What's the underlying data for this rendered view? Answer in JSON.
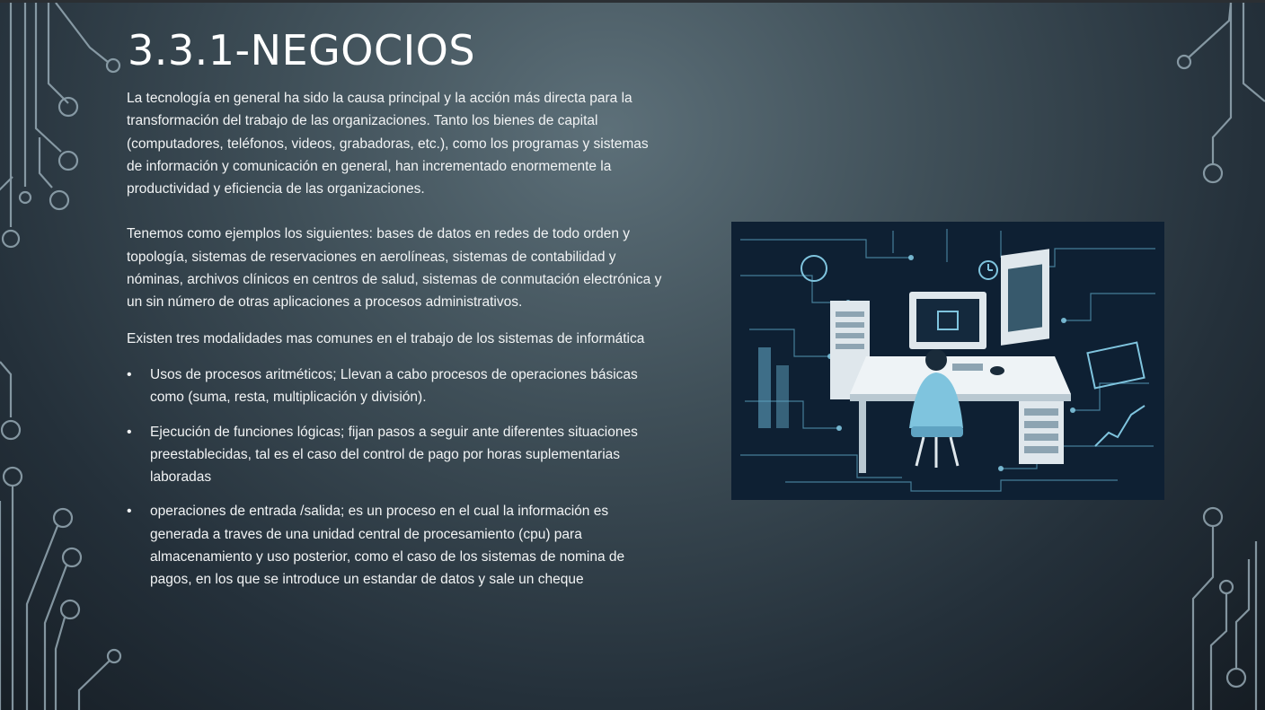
{
  "slide": {
    "title": "3.3.1-NEGOCIOS",
    "paragraphs": [
      "La tecnología en general ha sido la causa principal y la acción más directa para la transformación del trabajo de las organizaciones. Tanto los bienes de capital (computadores, teléfonos, videos, grabadoras, etc.), como los programas y sistemas de información y comunicación en general, han incrementado enormemente la productividad y eficiencia de las organizaciones.",
      "Tenemos como ejemplos los siguientes: bases de datos en redes de todo orden y topología, sistemas de reservaciones en aerolíneas, sistemas de contabilidad y nóminas, archivos clínicos en centros de salud, sistemas de conmutación electrónica y un sin número de otras aplicaciones a procesos administrativos.",
      "Existen tres modalidades mas comunes en el trabajo de los sistemas de informática"
    ],
    "bullet_marker": "•",
    "bullets": [
      "Usos de procesos aritméticos; Llevan a cabo procesos de operaciones básicas como  (suma, resta, multiplicación y división).",
      "Ejecución de funciones lógicas; fijan pasos a seguir ante diferentes situaciones preestablecidas, tal es el caso del control de pago por horas suplementarias laboradas",
      "operaciones de entrada /salida; es un proceso en el cual la información es generada a traves de una unidad central de procesamiento (cpu) para almacenamiento y uso posterior, como el caso de los sistemas de nomina de pagos, en los que se introduce un estandar de datos y sale un cheque"
    ]
  },
  "illustration": {
    "icon": "person-at-computer-circuit-illustration"
  },
  "colors": {
    "text": "#f2f4f5",
    "title": "#ffffff",
    "circuit_lines": "#9db1bc",
    "illustration_bg": "#0e2033",
    "illustration_accent": "#7fc4de"
  }
}
